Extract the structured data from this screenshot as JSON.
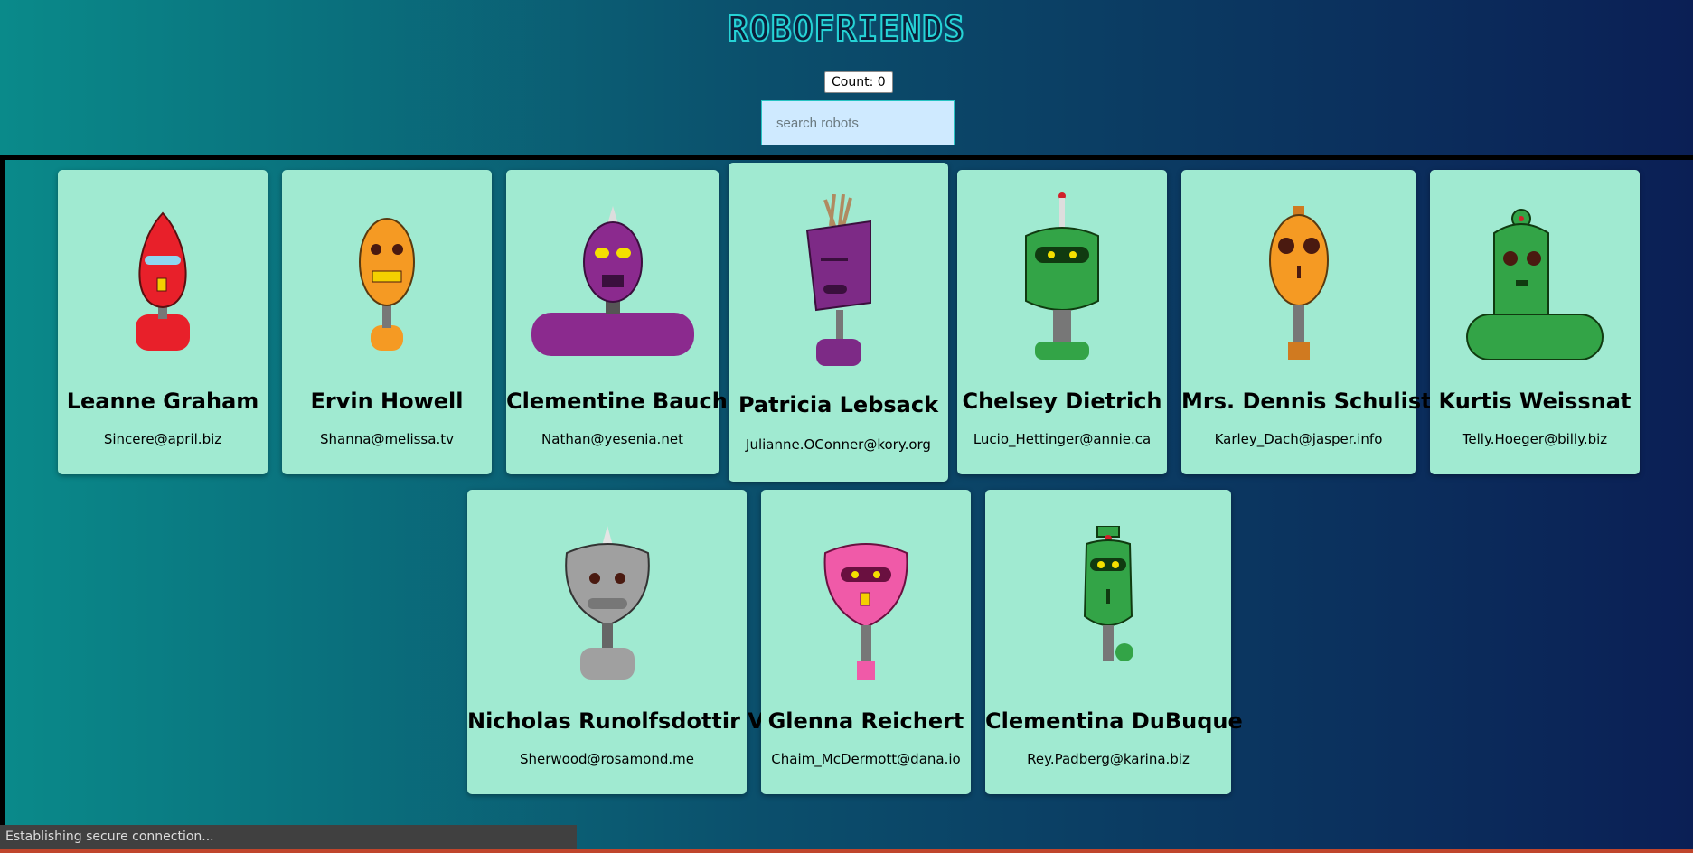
{
  "header": {
    "title": "ROBOFRIENDS",
    "count_label": "Count: 0",
    "search_placeholder": "search robots"
  },
  "robots": [
    {
      "name": "Leanne Graham",
      "email": "Sincere@april.biz",
      "color": "#e8202a"
    },
    {
      "name": "Ervin Howell",
      "email": "Shanna@melissa.tv",
      "color": "#f59a23"
    },
    {
      "name": "Clementine Bauch",
      "email": "Nathan@yesenia.net",
      "color": "#8b2a8e"
    },
    {
      "name": "Patricia Lebsack",
      "email": "Julianne.OConner@kory.org",
      "color": "#7d2a86"
    },
    {
      "name": "Chelsey Dietrich",
      "email": "Lucio_Hettinger@annie.ca",
      "color": "#33a447"
    },
    {
      "name": "Mrs. Dennis Schulist",
      "email": "Karley_Dach@jasper.info",
      "color": "#f59a23"
    },
    {
      "name": "Kurtis Weissnat",
      "email": "Telly.Hoeger@billy.biz",
      "color": "#33a447"
    },
    {
      "name": "Nicholas Runolfsdottir V",
      "email": "Sherwood@rosamond.me",
      "color": "#a0a0a0"
    },
    {
      "name": "Glenna Reichert",
      "email": "Chaim_McDermott@dana.io",
      "color": "#f05aa8"
    },
    {
      "name": "Clementina DuBuque",
      "email": "Rey.Padberg@karina.biz",
      "color": "#33a447"
    }
  ],
  "status_bar": {
    "text": "Establishing secure connection..."
  }
}
